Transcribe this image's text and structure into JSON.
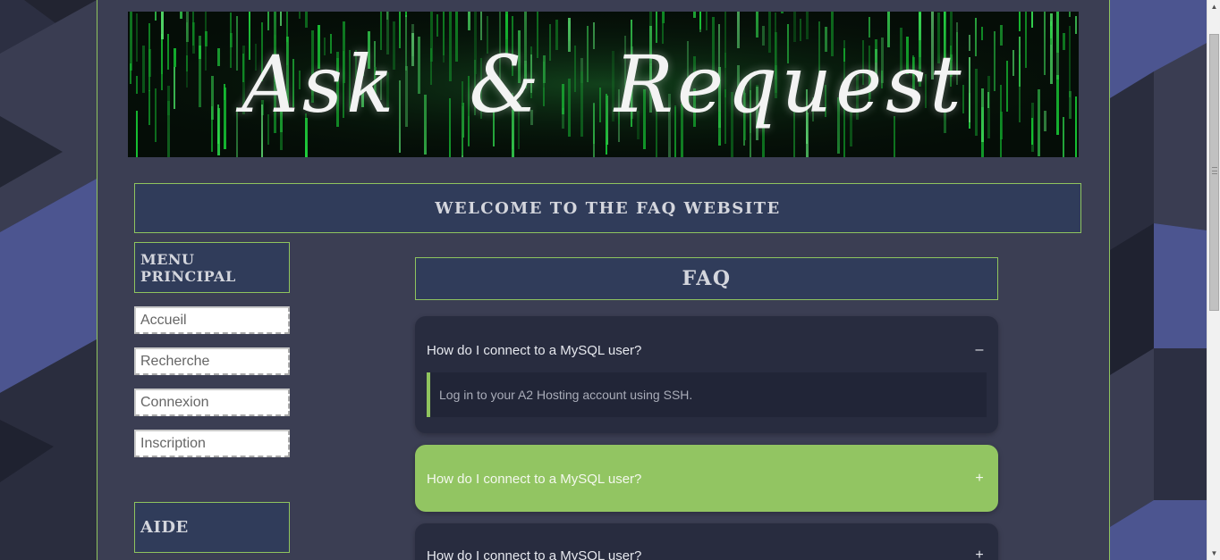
{
  "banner": {
    "title_left": "Ask",
    "title_mid": "&",
    "title_right": "Request"
  },
  "welcome": {
    "text": "WELCOME TO THE FAQ WEBSITE"
  },
  "sidebar": {
    "menu_title": "MENU PRINCIPAL",
    "inputs": [
      {
        "placeholder": "Accueil"
      },
      {
        "placeholder": "Recherche"
      },
      {
        "placeholder": "Connexion"
      },
      {
        "placeholder": "Inscription"
      }
    ],
    "help_title": "AIDE"
  },
  "faq": {
    "title": "FAQ",
    "items": [
      {
        "question": "How do I connect to a MySQL user?",
        "toggle": "–",
        "answer": "Log in to your A2 Hosting account using SSH."
      },
      {
        "question": "How do I connect to a MySQL user?",
        "toggle": "+"
      },
      {
        "question": "How do I connect to a MySQL user?",
        "toggle": "+"
      }
    ]
  },
  "colors": {
    "accent_green": "#8fc45e",
    "panel_blue": "#303c5a",
    "page_bg": "#3b3e53",
    "faq_item_bg": "#282c3f"
  },
  "scrollbar": {
    "up_icon": "▲",
    "down_icon": "▼"
  }
}
